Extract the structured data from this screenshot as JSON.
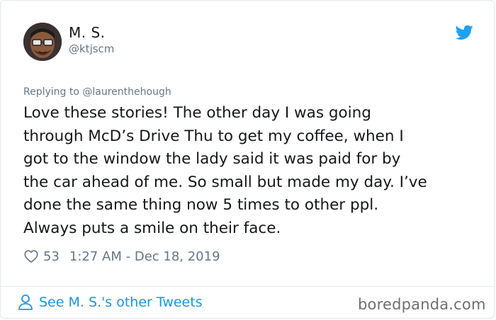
{
  "author": {
    "name": "M. S.",
    "handle": "@ktjscm"
  },
  "icons": {
    "brand": "twitter-bird-icon",
    "like": "heart-outline-icon",
    "profile": "person-outline-icon"
  },
  "reply": {
    "text": "Replying to @laurenthehough"
  },
  "tweet": {
    "text": "Love these stories! The other day I was going\nthrough McD’s Drive Thu to get my coffee, when I\ngot to the window the lady said it was paid for by\nthe car ahead of me. So small but made my day. I’ve\ndone the same thing now 5 times to other ppl.\nAlways puts a smile on their face."
  },
  "meta": {
    "likes": "53",
    "timestamp": "1:27 AM - Dec 18, 2019"
  },
  "footer": {
    "link_label": "See M. S.'s other Tweets",
    "watermark": "boredpanda.com"
  },
  "colors": {
    "accent": "#1da1f2",
    "link": "#1b95e0",
    "secondary_text": "#657786",
    "primary_text": "#14171a"
  }
}
